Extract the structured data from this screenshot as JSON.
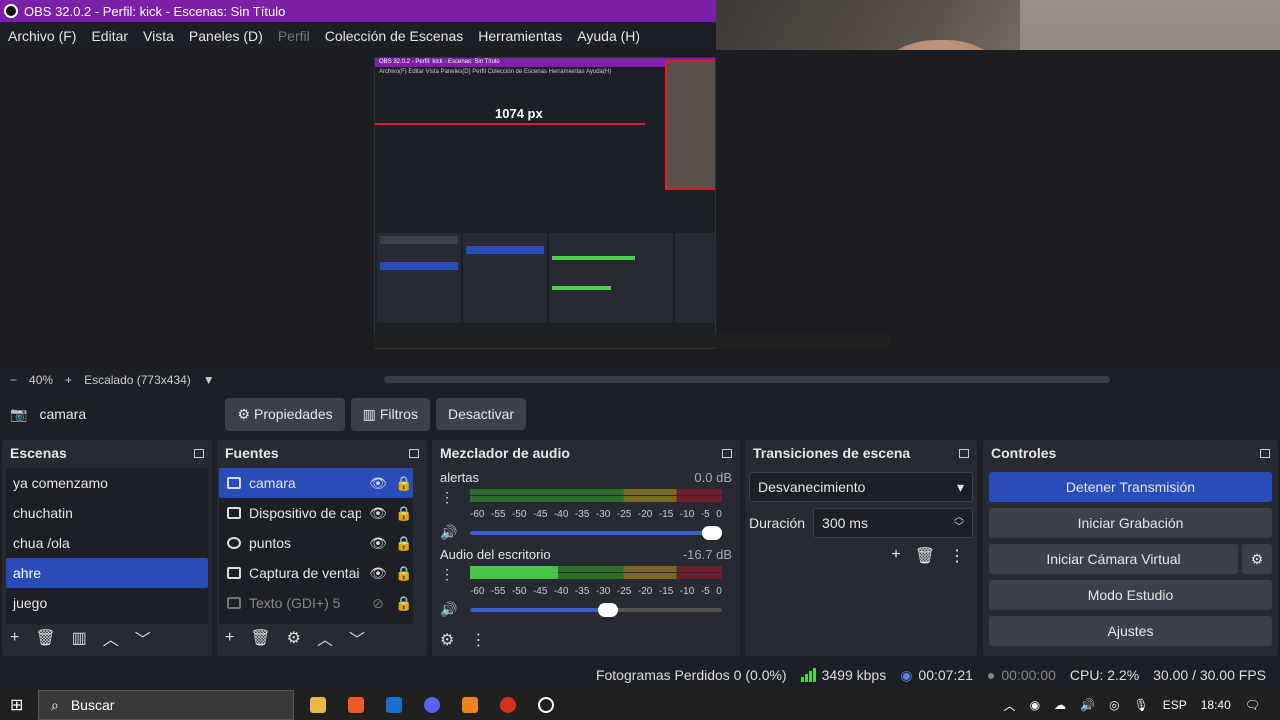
{
  "window": {
    "title": "OBS 32.0.2 - Perfil: kick - Escenas: Sin Título"
  },
  "menu": [
    "Archivo (F)",
    "Editar",
    "Vista",
    "Paneles (D)",
    "Perfil",
    "Colección de Escenas",
    "Herramientas",
    "Ayuda (H)"
  ],
  "menu_disabled": "Perfil",
  "preview": {
    "nested_title": "OBS 32.0.2 - Perfil: kick - Escenas: Sin Título",
    "nested_menu": "Archivo(F)  Editar  Vista  Paneles(D)  Perfil  Colección de Escenas  Herramientas  Ayuda(H)",
    "nested_px_label": "1074 px",
    "nested_small_label": "1074 px"
  },
  "zoom": {
    "minus": "−",
    "value": "40%",
    "plus": "+",
    "scale_label": "Escalado (773x434)"
  },
  "source_toolbar": {
    "name": "camara",
    "properties": "Propiedades",
    "filters": "Filtros",
    "deactivate": "Desactivar"
  },
  "scenes": {
    "title": "Escenas",
    "items": [
      "ya comenzamo",
      "chuchatin",
      "chua /ola",
      "ahre",
      "juego"
    ],
    "selected": "ahre"
  },
  "sources": {
    "title": "Fuentes",
    "items": [
      {
        "label": "camara",
        "icon": "camera-icon",
        "selected": true,
        "visible": true
      },
      {
        "label": "Dispositivo de cap",
        "icon": "camera-icon",
        "selected": false,
        "visible": true
      },
      {
        "label": "puntos",
        "icon": "chrome-icon",
        "selected": false,
        "visible": true
      },
      {
        "label": "Captura de ventai",
        "icon": "window-icon",
        "selected": false,
        "visible": true
      },
      {
        "label": "Texto (GDI+) 5",
        "icon": "text-icon",
        "selected": false,
        "visible": false
      }
    ]
  },
  "mixer": {
    "title": "Mezclador de audio",
    "channels": [
      {
        "name": "alertas",
        "db": "0.0 dB",
        "level": 0.0,
        "volume": 1.0
      },
      {
        "name": "Audio del escritorio",
        "db": "-16.7 dB",
        "level": 0.35,
        "volume": 0.55
      }
    ],
    "scale": [
      "-60",
      "-55",
      "-50",
      "-45",
      "-40",
      "-35",
      "-30",
      "-25",
      "-20",
      "-15",
      "-10",
      "-5",
      "0"
    ]
  },
  "transitions": {
    "title": "Transiciones de escena",
    "selected": "Desvanecimiento",
    "duration_label": "Duración",
    "duration_value": "300 ms"
  },
  "controls": {
    "title": "Controles",
    "stop_stream": "Detener Transmisión",
    "start_recording": "Iniciar Grabación",
    "start_virtual_cam": "Iniciar Cámara Virtual",
    "studio_mode": "Modo Estudio",
    "settings": "Ajustes"
  },
  "status": {
    "dropped": "Fotogramas Perdidos 0 (0.0%)",
    "kbps": "3499 kbps",
    "stream_time": "00:07:21",
    "rec_time": "00:00:00",
    "cpu": "CPU: 2.2%",
    "fps": "30.00 / 30.00 FPS"
  },
  "taskbar": {
    "search_placeholder": "Buscar",
    "lang": "ESP",
    "time": "18:40"
  },
  "colors": {
    "accent": "#284cb8",
    "titlebar": "#7c1fa9",
    "meter_green": "#4fd34a",
    "background": "#1d1f26",
    "panel": "#272a33"
  }
}
